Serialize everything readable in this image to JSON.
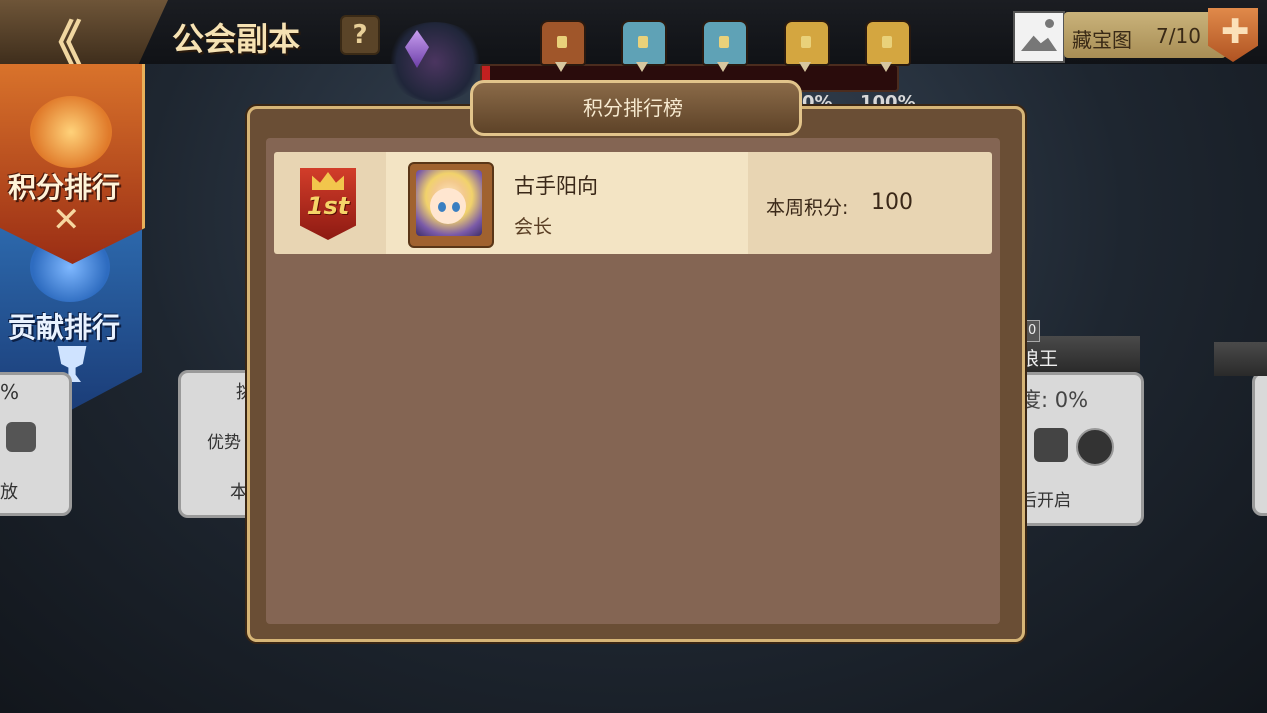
{
  "header": {
    "back_glyph": "《",
    "title": "公会副本",
    "help_glyph": "?"
  },
  "progress": {
    "fill_fraction": 0.02,
    "chest_colors": [
      "#a0562a",
      "#5fa2b6",
      "#5fa2b6",
      "#d4a640",
      "#d4a640"
    ],
    "percent_labels": [
      "0%",
      "100%"
    ]
  },
  "treasure": {
    "label": "藏宝图",
    "count": "7/10",
    "add_glyph": "✚"
  },
  "side_tabs": {
    "score_rank": "积分排行",
    "contribution_rank": "贡献排行"
  },
  "background_cards": {
    "left_pct": "%",
    "left_status": "放",
    "card2_line1": "优势",
    "card2_line2": "本",
    "card2_title": "挑",
    "boss_level": "20",
    "boss_name": "狼王",
    "boss_progress": "度: 0%",
    "boss_status": "后开启"
  },
  "modal": {
    "title": "积分排行榜",
    "rows": [
      {
        "rank": "1st",
        "name": "古手阳向",
        "role": "会长",
        "score_label": "本周积分:",
        "score": "100"
      }
    ]
  }
}
